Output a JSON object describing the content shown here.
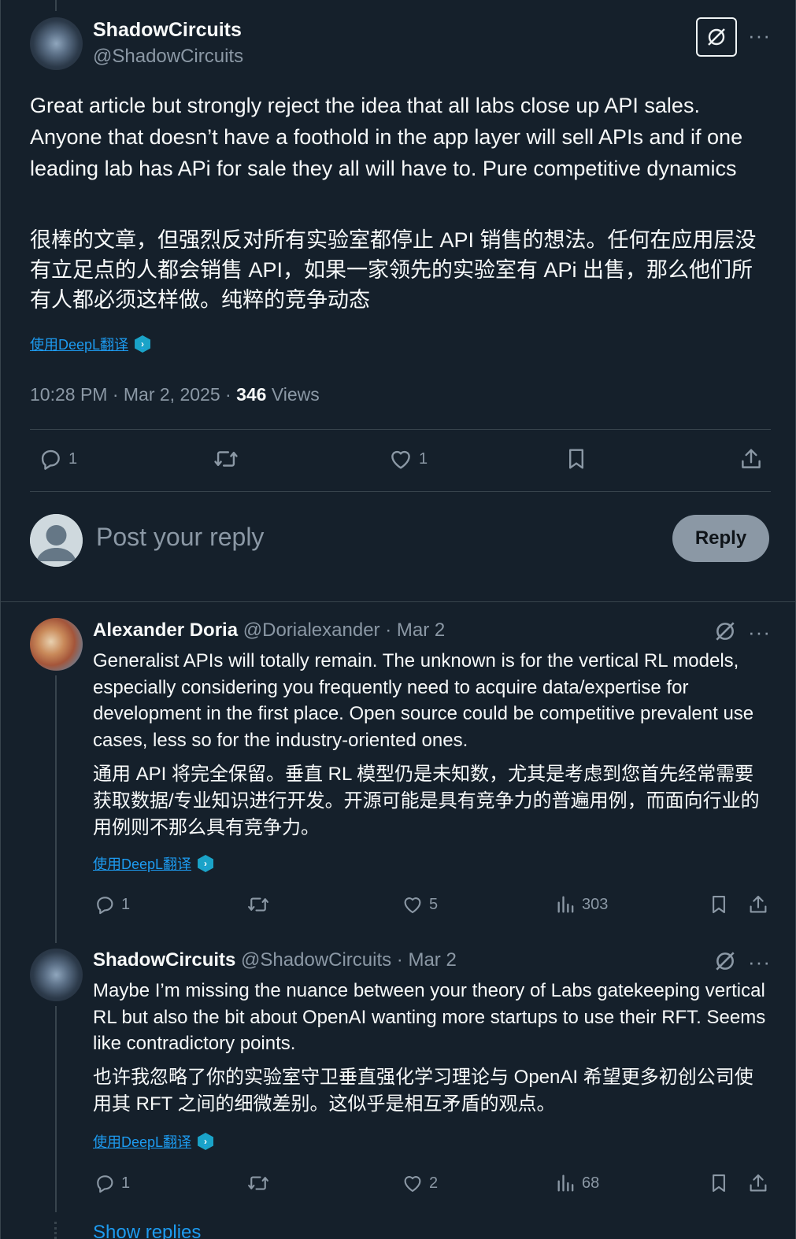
{
  "main_post": {
    "name": "ShadowCircuits",
    "handle": "@ShadowCircuits",
    "text_en": "Great article but strongly reject the idea that all labs close up API sales. Anyone that doesn’t have a foothold in the app layer will sell APIs and if one leading lab has APi for sale they all will have to. Pure competitive dynamics",
    "text_zh": "很棒的文章，但强烈反对所有实验室都停止 API 销售的想法。任何在应用层没有立足点的人都会销售 API，如果一家领先的实验室有 APi 出售，那么他们所有人都必须这样做。纯粹的竞争动态",
    "translate_link": "使用DeepL翻译",
    "timestamp": "10:28 PM · Mar 2, 2025 · ",
    "views_count": "346",
    "views_label": " Views",
    "reply_count": "1",
    "like_count": "1"
  },
  "composer": {
    "placeholder": "Post your reply",
    "reply_button": "Reply"
  },
  "replies": [
    {
      "name": "Alexander Doria",
      "handle": "@Dorialexander",
      "date": " · Mar 2",
      "text_en": "Generalist APIs will totally remain. The unknown is for the vertical RL models, especially considering you frequently need to acquire data/expertise for development in the first place. Open source could be competitive prevalent use cases, less so for the industry-oriented ones.",
      "text_zh": "通用 API 将完全保留。垂直 RL 模型仍是未知数，尤其是考虑到您首先经常需要获取数据/专业知识进行开发。开源可能是具有竞争力的普遍用例，而面向行业的用例则不那么具有竞争力。",
      "translate_link": "使用DeepL翻译",
      "reply_count": "1",
      "like_count": "5",
      "view_count": "303"
    },
    {
      "name": "ShadowCircuits",
      "handle": "@ShadowCircuits",
      "date": " · Mar 2",
      "text_en": "Maybe I’m missing the nuance between your theory of Labs gatekeeping vertical RL but also the bit about OpenAI wanting more startups to use their RFT. Seems like contradictory points.",
      "text_zh": "也许我忽略了你的实验室守卫垂直强化学习理论与 OpenAI 希望更多初创公司使用其 RFT 之间的细微差别。这似乎是相互矛盾的观点。",
      "translate_link": "使用DeepL翻译",
      "reply_count": "1",
      "like_count": "2",
      "view_count": "68"
    }
  ],
  "show_replies": "Show replies",
  "icons": {
    "grok": "grok-icon",
    "more": "more-icon",
    "reply": "reply-icon",
    "repost": "repost-icon",
    "like": "heart-icon",
    "bookmark": "bookmark-icon",
    "share": "share-icon",
    "views": "views-icon"
  },
  "colors": {
    "background": "#15202b",
    "text": "#f7f9f9",
    "muted": "#8b98a5",
    "link": "#1d9bf0",
    "border": "#38444d"
  }
}
